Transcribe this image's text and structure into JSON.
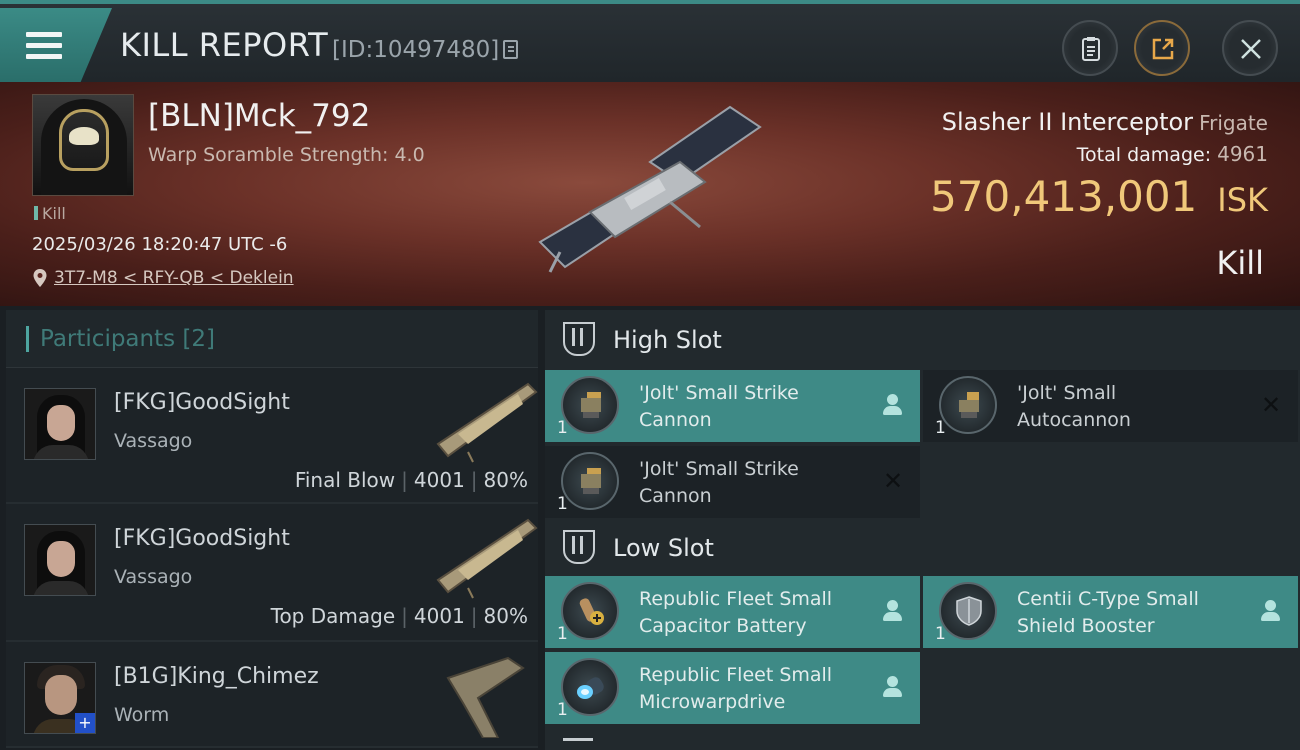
{
  "header": {
    "title": "KILL REPORT",
    "report_id": "[ID:10497480]"
  },
  "victim": {
    "name": "[BLN]Mck_792",
    "warp_scramble": "Warp Soramble Strength: 4.0",
    "tag": "Kill",
    "datetime": "2025/03/26 18:20:47 UTC -6",
    "location": "3T7-M8 < RFY-QB < Deklein",
    "ship_name": "Slasher II Interceptor",
    "ship_class": "Frigate",
    "total_damage_label": "Total damage:",
    "total_damage": "4961",
    "isk_value": "570,413,001",
    "isk_unit": "ISK",
    "result": "Kill"
  },
  "participants": {
    "label": "Participants",
    "count": "[2]",
    "rows": [
      {
        "name": "[FKG]GoodSight",
        "ship": "Vassago",
        "role": "Final Blow",
        "damage": "4001",
        "percent": "80%"
      },
      {
        "name": "[FKG]GoodSight",
        "ship": "Vassago",
        "role": "Top Damage",
        "damage": "4001",
        "percent": "80%"
      },
      {
        "name": "[B1G]King_Chimez",
        "ship": "Worm"
      }
    ]
  },
  "fitting": {
    "high_slot_label": "High Slot",
    "low_slot_label": "Low Slot",
    "high": [
      {
        "qty": "1",
        "name_line1": "'Jolt' Small Strike",
        "name_line2": "Cannon",
        "status": "person-icon"
      },
      {
        "qty": "1",
        "name_line1": "'Jolt' Small",
        "name_line2": "Autocannon",
        "status": "close-icon"
      },
      {
        "qty": "1",
        "name_line1": "'Jolt' Small Strike",
        "name_line2": "Cannon",
        "status": "close-icon"
      }
    ],
    "low": [
      {
        "qty": "1",
        "name_line1": "Republic Fleet Small",
        "name_line2": "Capacitor Battery",
        "status": "person-icon"
      },
      {
        "qty": "1",
        "name_line1": "Centii C-Type Small",
        "name_line2": "Shield Booster",
        "status": "person-icon"
      },
      {
        "qty": "1",
        "name_line1": "Republic Fleet Small",
        "name_line2": "Microwarpdrive",
        "status": "person-icon"
      }
    ]
  },
  "colors": {
    "accent": "#3e8a86",
    "isk": "#f0c87a",
    "banner": "#6b3128"
  }
}
